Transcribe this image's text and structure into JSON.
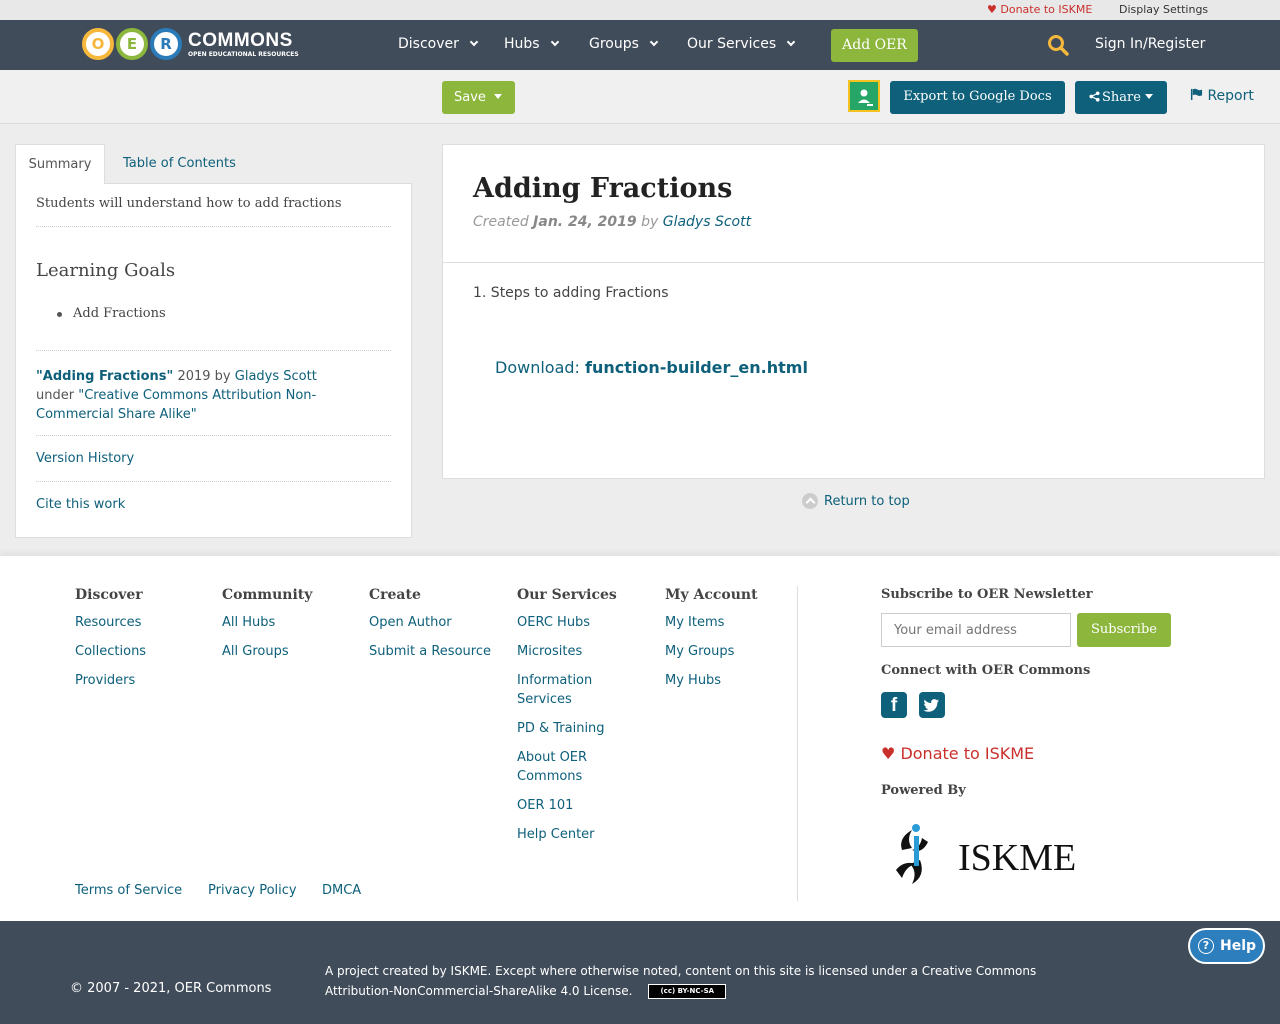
{
  "utility": {
    "donate": "Donate to ISKME",
    "display_settings": "Display Settings"
  },
  "brand": {
    "logo_letters": [
      "O",
      "E",
      "R"
    ],
    "logo_colors": [
      "#f5b83d",
      "#8cb63c",
      "#2b7bb9"
    ],
    "wordmark": "COMMONS",
    "tagline": "OPEN EDUCATIONAL RESOURCES"
  },
  "nav": {
    "items": [
      "Discover",
      "Hubs",
      "Groups",
      "Our Services"
    ],
    "add_oer": "Add OER",
    "sign_in": "Sign In/Register"
  },
  "actions": {
    "save": "Save",
    "export": "Export to Google Docs",
    "share": "Share",
    "report": "Report"
  },
  "sidebar": {
    "tabs": [
      "Summary",
      "Table of Contents"
    ],
    "summary": "Students will understand how to add fractions",
    "learning_goals_title": "Learning Goals",
    "learning_goals": [
      "Add Fractions"
    ],
    "attribution": {
      "title": "\"Adding Fractions\"",
      "year": "2019",
      "by": "by",
      "author": "Gladys Scott",
      "under": "under",
      "license": "\"Creative Commons Attribution Non-Commercial Share Alike\""
    },
    "version_history": "Version History",
    "cite": "Cite this work"
  },
  "content": {
    "title": "Adding Fractions",
    "created_label": "Created",
    "created_date": "Jan. 24, 2019",
    "by": "by",
    "author": "Gladys Scott",
    "step": "1. Steps to adding Fractions",
    "download_label": "Download:",
    "download_file": "function-builder_en.html",
    "return_top": "Return to top"
  },
  "footer": {
    "columns": [
      {
        "title": "Discover",
        "links": [
          "Resources",
          "Collections",
          "Providers"
        ]
      },
      {
        "title": "Community",
        "links": [
          "All Hubs",
          "All Groups"
        ]
      },
      {
        "title": "Create",
        "links": [
          "Open Author",
          "Submit a Resource"
        ]
      },
      {
        "title": "Our Services",
        "links": [
          "OERC Hubs",
          "Microsites",
          "Information Services",
          "PD & Training",
          "About OER Commons",
          "OER 101",
          "Help Center"
        ]
      },
      {
        "title": "My Account",
        "links": [
          "My Items",
          "My Groups",
          "My Hubs"
        ]
      }
    ],
    "newsletter_title": "Subscribe to OER Newsletter",
    "email_placeholder": "Your email address",
    "subscribe": "Subscribe",
    "connect": "Connect with OER Commons",
    "facebook_glyph": "f",
    "donate": "Donate to ISKME",
    "powered_by": "Powered By",
    "iskme_logo_text": "ISKME",
    "legal_links": [
      "Terms of Service",
      "Privacy Policy",
      "DMCA"
    ]
  },
  "bottom": {
    "copyright": "© 2007 - 2021, OER Commons",
    "license_text": "A project created by ISKME. Except where otherwise noted, content on this site is licensed under a Creative Commons Attribution-NonCommercial-ShareAlike 4.0 License.",
    "cc_badge": "(cc) BY-NC-SA",
    "help": "Help",
    "help_glyph": "?"
  },
  "colors": {
    "nav_bg": "#414c5a",
    "accent_green": "#8cb63c",
    "accent_teal": "#0e607b",
    "donate_red": "#c9302c"
  }
}
